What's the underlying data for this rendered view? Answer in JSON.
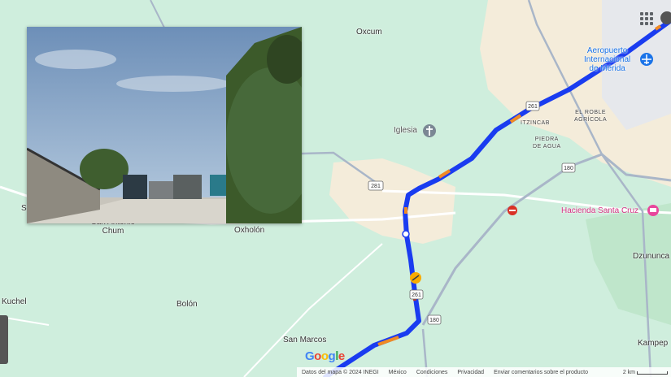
{
  "places": {
    "oxcum": "Oxcum",
    "iglesia": "Iglesia",
    "itzincab": "ITZINCAB",
    "piedra_line1": "PIEDRA",
    "piedra_line2": "DE AGUA",
    "el_roble_line1": "EL ROBLE",
    "el_roble_line2": "AGRÍCOLA",
    "airport_line1": "Aeropuerto",
    "airport_line2": "Internacional",
    "airport_line3": "de Mérida",
    "hacienda": "Hacienda Santa Cruz",
    "san_antonio_line1": "San Antonio",
    "san_antonio_line2": "Chum",
    "oxholon": "Oxholón",
    "kuchel": "Kuchel",
    "bolon": "Bolón",
    "san_marcos": "San Marcos",
    "dzununcan": "Dzununca",
    "kampep": "Kampep",
    "s_cut": "S"
  },
  "shields": {
    "r261_top": "261",
    "r261_mid": "261",
    "r281": "281",
    "r180_top": "180",
    "r180_bottom": "180"
  },
  "footer": {
    "google": "Google",
    "datos": "Datos del mapa © 2024 INEGI",
    "mexico": "México",
    "condiciones": "Condiciones",
    "privacidad": "Privacidad",
    "comentarios": "Enviar comentarios sobre el producto",
    "scale": "2 km"
  },
  "colors": {
    "map_background": "#cfeedd",
    "urban": "#f4ecda",
    "route": "#1a3cf0",
    "traffic_orange": "#f08a24",
    "road": "#ffffff",
    "road_major": "#a9b6c8"
  },
  "icons": [
    "airport-icon",
    "church-icon",
    "hotel-icon",
    "no-entry-icon",
    "construction-icon",
    "apps-grid-icon"
  ]
}
